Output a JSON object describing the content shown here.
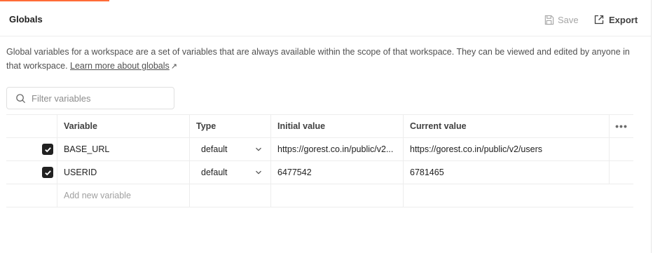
{
  "header": {
    "title": "Globals",
    "save_label": "Save",
    "export_label": "Export"
  },
  "description": {
    "text": "Global variables for a workspace are a set of variables that are always available within the scope of that workspace. They can be viewed and edited by anyone in that workspace. ",
    "link_label": "Learn more about globals",
    "link_arrow": "↗"
  },
  "filter": {
    "placeholder": "Filter variables"
  },
  "table": {
    "columns": {
      "variable": "Variable",
      "type": "Type",
      "initial": "Initial value",
      "current": "Current value",
      "more": "•••"
    },
    "rows": [
      {
        "checked": true,
        "variable": "BASE_URL",
        "type": "default",
        "initial": "https://gorest.co.in/public/v2...",
        "current": "https://gorest.co.in/public/v2/users"
      },
      {
        "checked": true,
        "variable": "USERID",
        "type": "default",
        "initial": "6477542",
        "current": "6781465"
      }
    ],
    "new_variable_placeholder": "Add new variable"
  },
  "colors": {
    "accent": "#ff6c37",
    "checkbox": "#212121"
  },
  "icons": {
    "save": "floppy-disk-icon",
    "export": "export-icon",
    "search": "search-icon",
    "chevron": "chevron-down-icon",
    "check": "check-icon"
  }
}
